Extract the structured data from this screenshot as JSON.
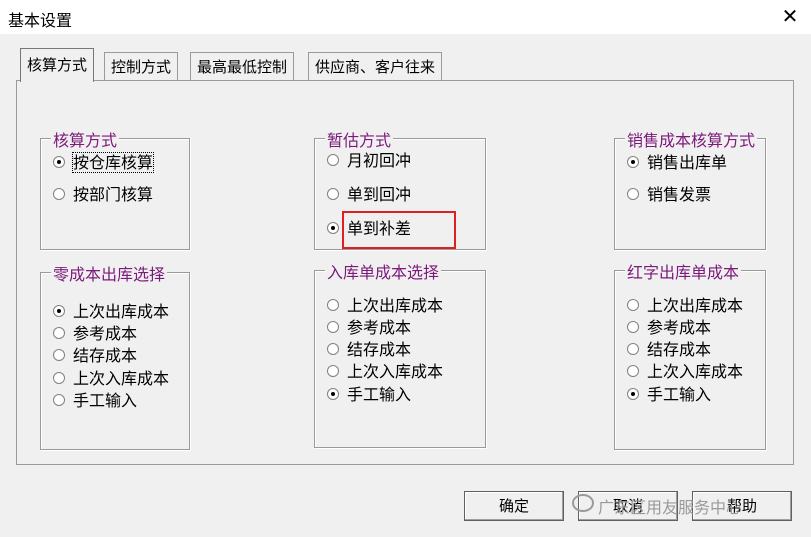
{
  "window": {
    "title": "基本设置",
    "close_glyph": "✕"
  },
  "tabs": [
    {
      "label": "核算方式"
    },
    {
      "label": "控制方式"
    },
    {
      "label": "最高最低控制"
    },
    {
      "label": "供应商、客户往来"
    }
  ],
  "groups": {
    "accounting": {
      "legend": "核算方式",
      "options": [
        "按仓库核算",
        "按部门核算"
      ],
      "selected": 0
    },
    "estimate": {
      "legend": "暂估方式",
      "options": [
        "月初回冲",
        "单到回冲",
        "单到补差"
      ],
      "selected": 2
    },
    "sales_cost": {
      "legend": "销售成本核算方式",
      "options": [
        "销售出库单",
        "销售发票"
      ],
      "selected": 0
    },
    "zero_cost": {
      "legend": "零成本出库选择",
      "options": [
        "上次出库成本",
        "参考成本",
        "结存成本",
        "上次入库成本",
        "手工输入"
      ],
      "selected": 0
    },
    "inbound_cost": {
      "legend": "入库单成本选择",
      "options": [
        "上次出库成本",
        "参考成本",
        "结存成本",
        "上次入库成本",
        "手工输入"
      ],
      "selected": 4
    },
    "red_outbound": {
      "legend": "红字出库单成本",
      "options": [
        "上次出库成本",
        "参考成本",
        "结存成本",
        "上次入库成本",
        "手工输入"
      ],
      "selected": 4
    }
  },
  "buttons": {
    "ok": "确定",
    "cancel": "取消",
    "help": "帮助"
  },
  "watermark": {
    "text": "广东区用友服务中心"
  },
  "colors": {
    "legend": "#7b1a7b",
    "highlight": "#e02020"
  }
}
